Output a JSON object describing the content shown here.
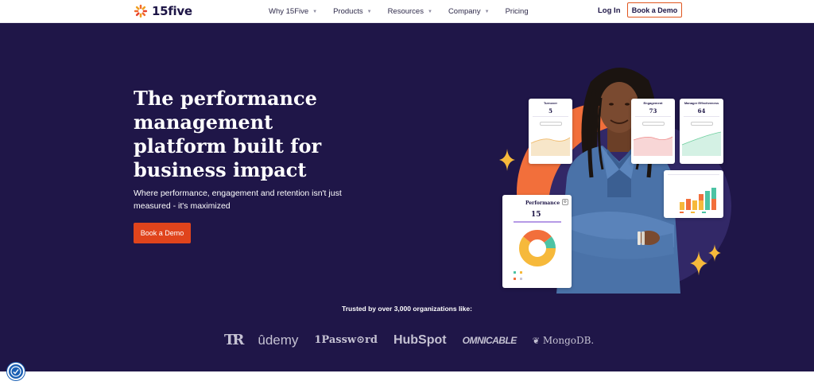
{
  "nav": {
    "logo_text": "15five",
    "menu": [
      {
        "label": "Why 15Five",
        "has_dropdown": true
      },
      {
        "label": "Products",
        "has_dropdown": true
      },
      {
        "label": "Resources",
        "has_dropdown": true
      },
      {
        "label": "Company",
        "has_dropdown": true
      },
      {
        "label": "Pricing",
        "has_dropdown": false
      }
    ],
    "login_label": "Log In",
    "demo_label": "Book a Demo"
  },
  "hero": {
    "headline": "The performance management platform built for business impact",
    "subheadline": "Where performance, engagement and retention isn't just measured - it's maximized",
    "cta_label": "Book a Demo"
  },
  "cards": {
    "turnover": {
      "title": "Turnover",
      "value": "5"
    },
    "engagement": {
      "title": "Engagement",
      "value": "73"
    },
    "manager": {
      "title": "Manager Effectiveness",
      "value": "64"
    },
    "performance": {
      "title": "Performance",
      "value": "15"
    }
  },
  "trusted": {
    "label": "Trusted by over 3,000 organizations like:",
    "brands": [
      "TR",
      "ûdemy",
      "1Passw⊙rd",
      "HubSpot",
      "OMNICABLE",
      "MongoDB."
    ]
  },
  "colors": {
    "hero_bg": "#1f1648",
    "accent_orange": "#e0441c",
    "circle_orange": "#f26f3b",
    "sparkle_yellow": "#f6b93b"
  },
  "icons": {
    "logo": "starburst-logo-icon",
    "accessibility": "accessibility-icon"
  }
}
